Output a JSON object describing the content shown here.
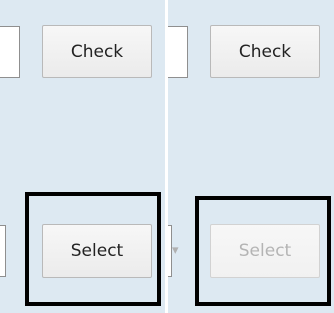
{
  "left_panel": {
    "check_label": "Check",
    "select_label": "Select",
    "select_enabled": true
  },
  "right_panel": {
    "check_label": "Check",
    "select_label": "Select",
    "select_enabled": false
  },
  "colors": {
    "panel_background": "#dde9f2",
    "highlight_border": "#000000",
    "disabled_text": "#b4b4b4"
  }
}
